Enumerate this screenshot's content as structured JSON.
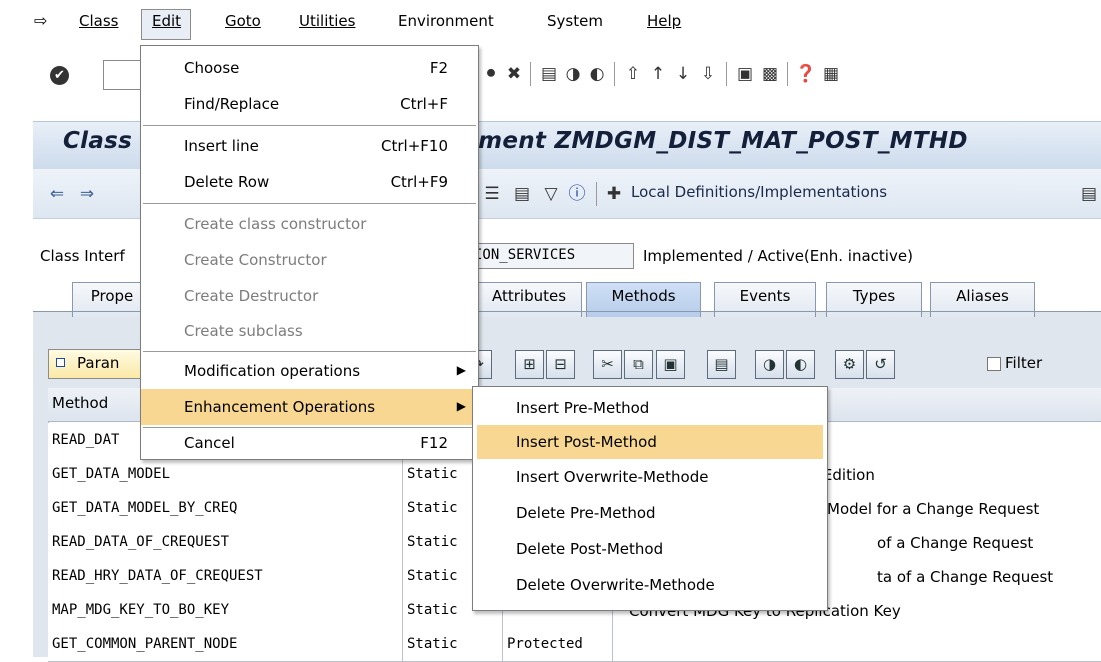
{
  "menubar": {
    "items": [
      "Class",
      "Edit",
      "Goto",
      "Utilities",
      "Environment",
      "System",
      "Help"
    ]
  },
  "title": "Class Builder: Enhancement ZMDGM_DIST_MAT_POST_MTHD",
  "title_visible": "Class",
  "title_visible_right": "ement ZMDGM_DIST_MAT_POST_MTHD",
  "app_toolbar": {
    "local_defs": "Local Definitions/Implementations"
  },
  "class_interface": {
    "label": "Class Interf",
    "value": "ION_SERVICES",
    "status": "Implemented / Active(Enh. inactive)"
  },
  "tabs": [
    {
      "label": "Prope",
      "active": false
    },
    {
      "label": "Attributes",
      "active": false
    },
    {
      "label": "Methods",
      "active": true
    },
    {
      "label": "Events",
      "active": false
    },
    {
      "label": "Types",
      "active": false
    },
    {
      "label": "Aliases",
      "active": false
    }
  ],
  "methods_toolbar": {
    "param_label": "Paran",
    "filter_label": "Filter"
  },
  "table": {
    "header": {
      "method": "Method"
    },
    "rows": [
      {
        "method": "READ_DAT",
        "level": "",
        "visibility": "",
        "description": ""
      },
      {
        "method": "GET_DATA_MODEL",
        "level": "Static",
        "visibility": "",
        "description": "r Edition"
      },
      {
        "method": "GET_DATA_MODEL_BY_CREQ",
        "level": "Static",
        "visibility": "",
        "description": "Model for a Change Request"
      },
      {
        "method": "READ_DATA_OF_CREQUEST",
        "level": "Static",
        "visibility": "",
        "description": "of a Change Request"
      },
      {
        "method": "READ_HRY_DATA_OF_CREQUEST",
        "level": "Static",
        "visibility": "",
        "description": "ta of a Change Request"
      },
      {
        "method": "MAP_MDG_KEY_TO_BO_KEY",
        "level": "Static",
        "visibility": "",
        "description": "Convert MDG Key to Replication Key"
      },
      {
        "method": "GET_COMMON_PARENT_NODE",
        "level": "Static",
        "visibility": "Protected",
        "description": ""
      }
    ]
  },
  "edit_menu": {
    "items": [
      {
        "label": "Choose",
        "shortcut": "F2"
      },
      {
        "label": "Find/Replace",
        "shortcut": "Ctrl+F"
      },
      {
        "label": "Insert line",
        "shortcut": "Ctrl+F10"
      },
      {
        "label": "Delete Row",
        "shortcut": "Ctrl+F9"
      },
      {
        "label": "Create class constructor",
        "shortcut": ""
      },
      {
        "label": "Create Constructor",
        "shortcut": ""
      },
      {
        "label": "Create Destructor",
        "shortcut": ""
      },
      {
        "label": "Create subclass",
        "shortcut": ""
      },
      {
        "label": "Modification operations",
        "shortcut": ""
      },
      {
        "label": "Enhancement Operations",
        "shortcut": ""
      },
      {
        "label": "Cancel",
        "shortcut": "F12"
      }
    ]
  },
  "enhancement_submenu": {
    "items": [
      {
        "label": "Insert Pre-Method"
      },
      {
        "label": "Insert Post-Method"
      },
      {
        "label": "Insert Overwrite-Methode"
      },
      {
        "label": "Delete Pre-Method"
      },
      {
        "label": "Delete Post-Method"
      },
      {
        "label": "Delete Overwrite-Methode"
      }
    ]
  },
  "colors": {
    "menu_highlight": "#f7d791",
    "title_bg": "#cddbec",
    "tab_body_bg": "#dfe6ee"
  }
}
